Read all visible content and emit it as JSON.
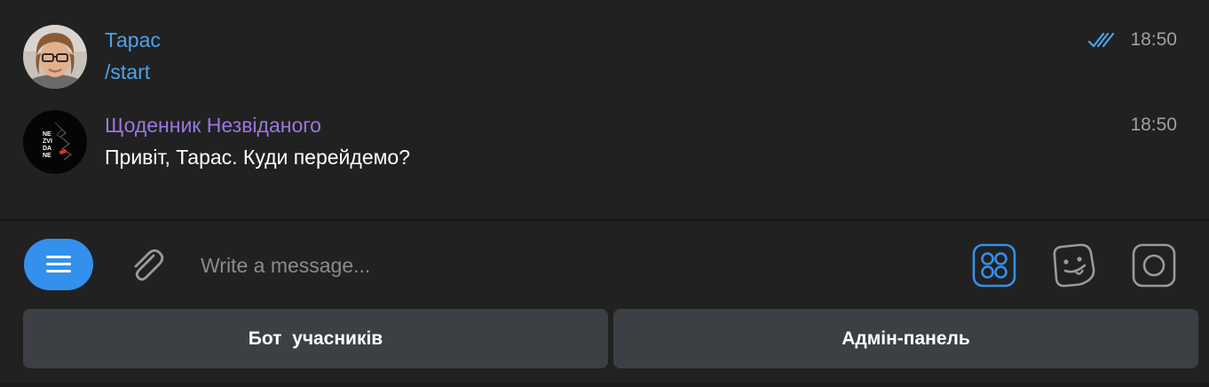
{
  "colors": {
    "background": "#212121",
    "user_name": "#4ea1ea",
    "link": "#4ea1ea",
    "bot_name": "#9a78e0",
    "accent": "#3390ec",
    "button_bg": "#3c4045",
    "muted": "#a0a0a0"
  },
  "messages": [
    {
      "sender": "Тарас",
      "text": "/start",
      "time": "18:50",
      "status": "read-double-check-icon",
      "avatar": "user-photo-avatar"
    },
    {
      "sender": "Щоденник Незвіданого",
      "text": "Привіт, Тарас. Куди перейдемо?",
      "time": "18:50",
      "avatar": "bot-logo-avatar",
      "avatar_logo_text": [
        "NE",
        "ZVI",
        "DA",
        "NE"
      ]
    }
  ],
  "composer": {
    "placeholder": "Write a message...",
    "menu_icon": "bot-menu-icon",
    "attach_icon": "paperclip-icon",
    "keyboard_icon": "bot-keyboard-icon",
    "sticker_icon": "sticker-icon",
    "camera_icon": "round-video-icon"
  },
  "reply_keyboard": {
    "buttons": [
      "Бот  учасників",
      "Адмін-панель"
    ]
  }
}
